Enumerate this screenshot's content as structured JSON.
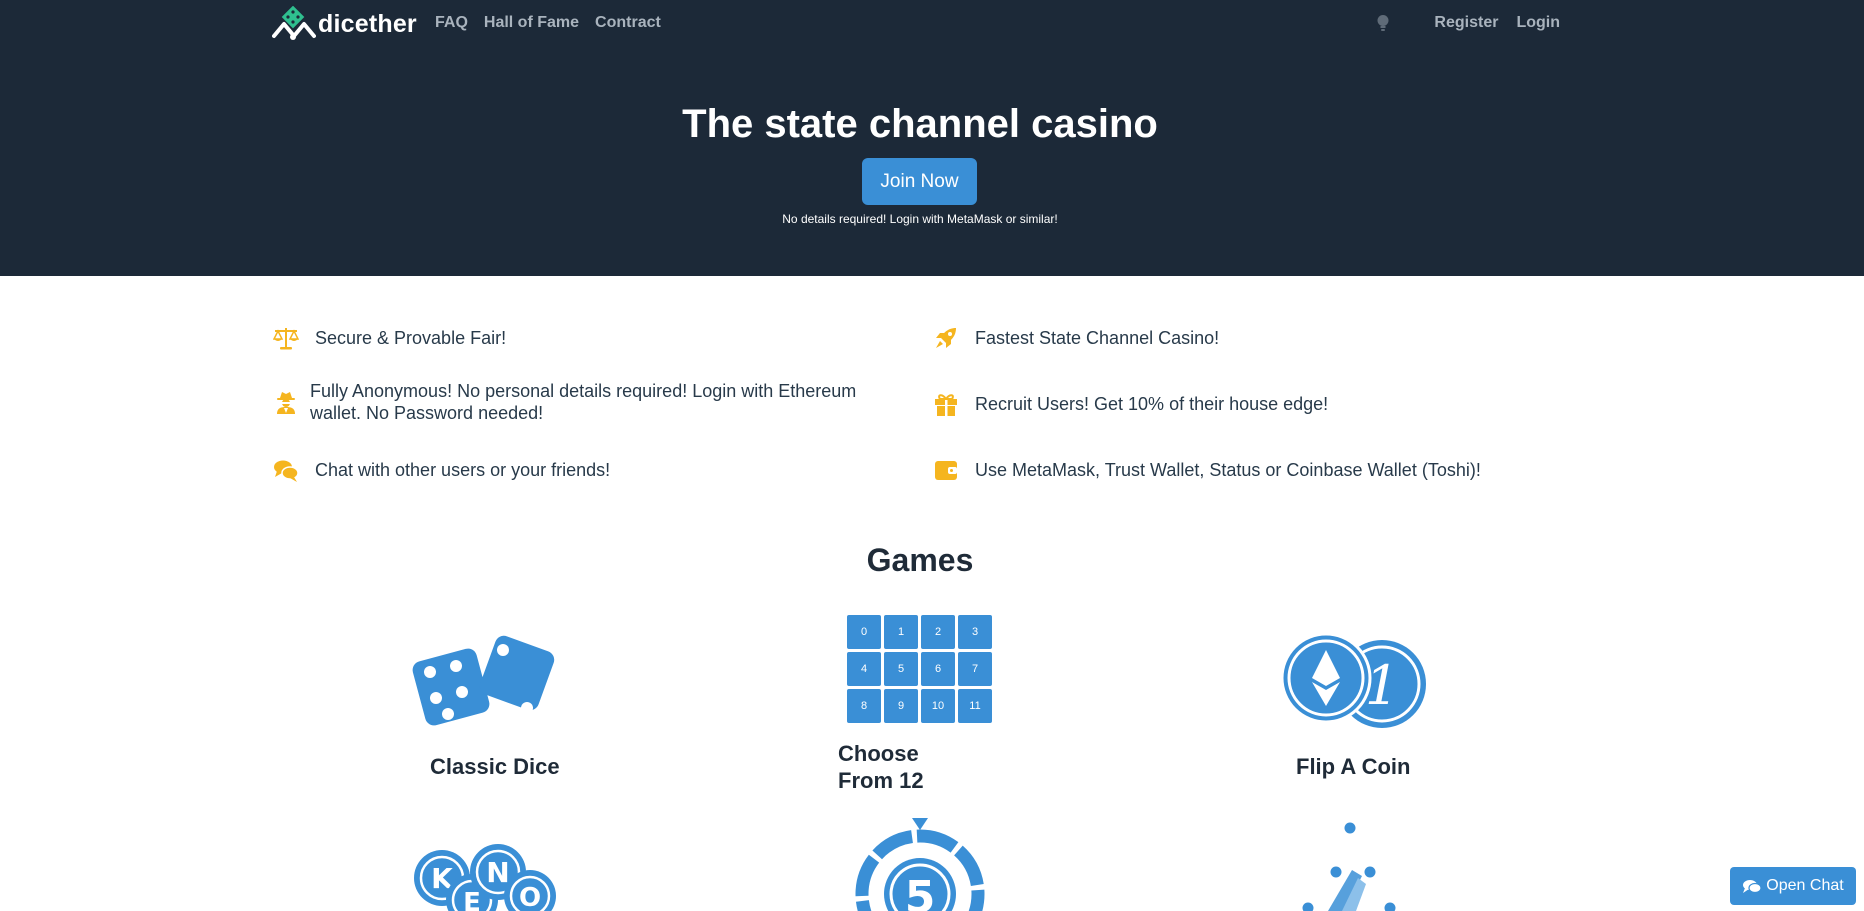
{
  "brand": {
    "name": "dicether"
  },
  "nav": {
    "links": [
      "FAQ",
      "Hall of Fame",
      "Contract"
    ],
    "register": "Register",
    "login": "Login"
  },
  "hero": {
    "title": "The state channel casino",
    "cta": "Join Now",
    "note": "No details required! Login with MetaMask or similar!"
  },
  "features": [
    {
      "icon": "scales-icon",
      "text": "Secure & Provable Fair!"
    },
    {
      "icon": "rocket-icon",
      "text": "Fastest State Channel Casino!"
    },
    {
      "icon": "user-secret-icon",
      "text": "Fully Anonymous! No personal details required! Login with Ethereum wallet. No Password needed!"
    },
    {
      "icon": "gift-icon",
      "text": "Recruit Users! Get 10% of their house edge!"
    },
    {
      "icon": "comments-icon",
      "text": "Chat with other users or your friends!"
    },
    {
      "icon": "wallet-icon",
      "text": "Use MetaMask, Trust Wallet, Status or Coinbase Wallet (Toshi)!"
    }
  ],
  "games": {
    "title": "Games",
    "items": [
      {
        "name": "Classic Dice",
        "icon": "dice-icon"
      },
      {
        "name": "Choose From 12",
        "icon": "number-grid-icon",
        "grid": [
          "0",
          "1",
          "2",
          "3",
          "4",
          "5",
          "6",
          "7",
          "8",
          "9",
          "10",
          "11"
        ]
      },
      {
        "name": "Flip A Coin",
        "icon": "coin-icon"
      },
      {
        "icon": "keno-icon",
        "letters": [
          "K",
          "E",
          "N",
          "O"
        ]
      },
      {
        "icon": "wheel-icon",
        "number": "5"
      },
      {
        "icon": "plinko-icon"
      }
    ]
  },
  "chat": {
    "label": "Open Chat"
  },
  "colors": {
    "header_bg": "#1c2938",
    "accent": "#3a8fd6",
    "feature_icon": "#f5b51f",
    "text_dark": "#1f2b38",
    "nav_link": "#a9b3bd"
  }
}
